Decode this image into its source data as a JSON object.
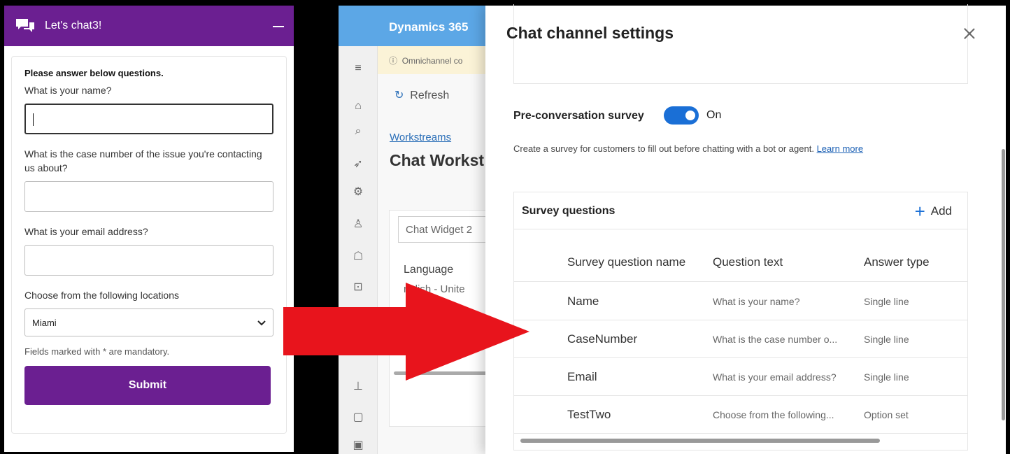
{
  "chat_widget": {
    "title": "Let's chat3!",
    "intro": "Please answer below questions.",
    "questions": [
      {
        "label": "What is your name?",
        "value": ""
      },
      {
        "label": "What is the case number of the issue you're contacting us about?",
        "value": ""
      },
      {
        "label": "What is your email address?",
        "value": ""
      }
    ],
    "location_label": "Choose from the following locations",
    "location_selected": "Miami",
    "mandatory_note": "Fields marked with * are mandatory.",
    "submit_label": "Submit",
    "accent_color": "#6b1f91"
  },
  "dynamics": {
    "app_title": "Dynamics 365",
    "banner": "Omnichannel co",
    "refresh_label": "Refresh",
    "breadcrumb": "Workstreams",
    "page_title": "Chat Workst",
    "widget_field": "Chat Widget 2",
    "language_label": "Language",
    "language_value": "nglish - Unite"
  },
  "settings_panel": {
    "title": "Chat channel settings",
    "pre_survey_label": "Pre-conversation survey",
    "pre_survey_state": "On",
    "description": "Create a survey for customers to fill out before chatting with a bot or agent.",
    "learn_more": "Learn more",
    "survey_section_title": "Survey questions",
    "add_label": "Add",
    "columns": [
      "Survey question name",
      "Question text",
      "Answer type"
    ],
    "rows": [
      {
        "name": "Name",
        "text": "What is your name?",
        "type": "Single line"
      },
      {
        "name": "CaseNumber",
        "text": "What is the case number o...",
        "type": "Single line"
      },
      {
        "name": "Email",
        "text": "What is your email address?",
        "type": "Single line"
      },
      {
        "name": "TestTwo",
        "text": "Choose from the following...",
        "type": "Option set"
      }
    ],
    "toggle_color": "#1a6fd6"
  },
  "annotation": {
    "arrow_color": "#e8141c"
  }
}
